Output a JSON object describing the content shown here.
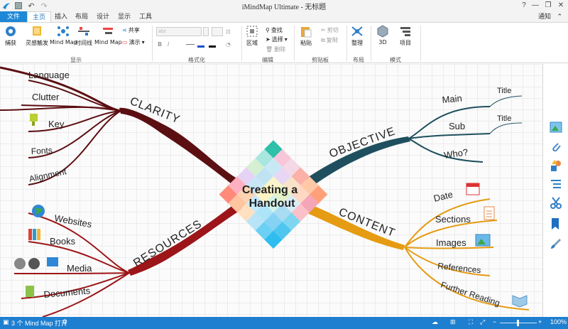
{
  "titlebar": {
    "title": "iMindMap Ultimate - 无标题",
    "help": "?",
    "minimize": "—",
    "restore": "❐",
    "close": "✕"
  },
  "tabs": [
    {
      "label": "文件"
    },
    {
      "label": "主页"
    },
    {
      "label": "插入"
    },
    {
      "label": "布局"
    },
    {
      "label": "设计"
    },
    {
      "label": "显示"
    },
    {
      "label": "工具"
    }
  ],
  "notify": "通知",
  "ribbon": {
    "capture": "捕获",
    "flash": "灵感触发",
    "mindmap": "Mind Map",
    "timeline": "时间线",
    "mindmap2": "Mind Map",
    "share": "共享",
    "present": "演示",
    "group_view": "显示",
    "group_format": "格式化",
    "font_placeholder": "abc",
    "area": "区域",
    "find": "查找",
    "select": "选择",
    "delete": "删除",
    "group_edit": "编辑",
    "paste": "粘贴",
    "cut": "剪切",
    "copy": "复制",
    "group_clipboard": "剪贴板",
    "arrange": "整理",
    "group_layout": "布局",
    "view3d": "3D",
    "project": "项目",
    "group_mode": "模式"
  },
  "map": {
    "central": [
      "Creating a",
      "Handout"
    ],
    "branches": {
      "clarity": {
        "label": "CLARITY",
        "color": "#5c0f12",
        "subs": [
          "Language",
          "Clutter",
          "Key",
          "Fonts",
          "Alignment"
        ]
      },
      "objective": {
        "label": "OBJECTIVE",
        "color": "#1f4f5e",
        "subs": [
          "Main",
          "Sub",
          "Who?"
        ],
        "subsubs": [
          "Title",
          "Title"
        ]
      },
      "resources": {
        "label": "RESOURCES",
        "color": "#9c1518",
        "subs": [
          "Websites",
          "Books",
          "Media",
          "Documents"
        ]
      },
      "content": {
        "label": "CONTENT",
        "color": "#e59b12",
        "subs": [
          "Date",
          "Sections",
          "Images",
          "References",
          "Further Reading"
        ]
      }
    }
  },
  "status": {
    "count": "3 个 Mind Map 打开",
    "zoom": "100%"
  },
  "colors": {
    "accent": "#1e7fd0"
  }
}
